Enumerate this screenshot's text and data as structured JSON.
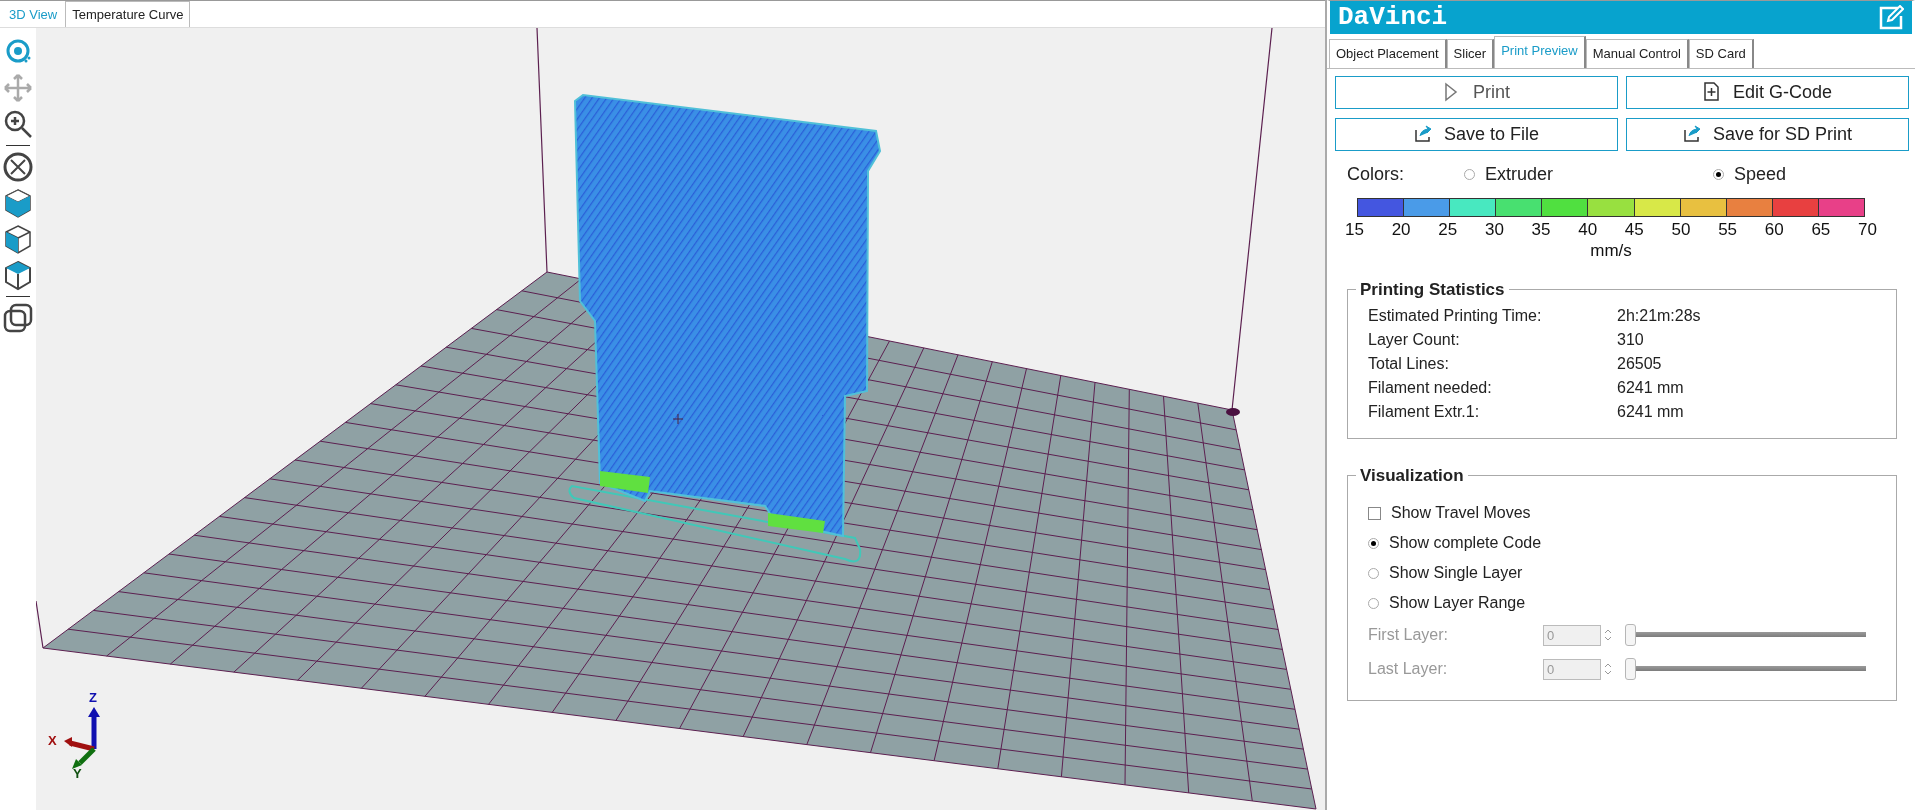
{
  "view_tabs": [
    {
      "label": "3D View",
      "selected": true
    },
    {
      "label": "Temperature Curve",
      "selected": false
    }
  ],
  "tools": [
    {
      "kind": "rotate",
      "selected": true,
      "disabled": false
    },
    {
      "kind": "move",
      "selected": false,
      "disabled": true
    },
    {
      "kind": "zoom",
      "selected": false,
      "disabled": false
    },
    {
      "kind": "separator"
    },
    {
      "kind": "fit",
      "selected": false,
      "disabled": false
    },
    {
      "kind": "cube-front",
      "selected": false,
      "disabled": false
    },
    {
      "kind": "cube-side",
      "selected": false,
      "disabled": false
    },
    {
      "kind": "cube-top",
      "selected": false,
      "disabled": false
    },
    {
      "kind": "separator"
    },
    {
      "kind": "views",
      "selected": false,
      "disabled": false
    }
  ],
  "axes": {
    "x": "X",
    "y": "Y",
    "z": "Z"
  },
  "panel": {
    "title": "DaVinci",
    "tabs": [
      {
        "label": "Object Placement",
        "selected": false
      },
      {
        "label": "Slicer",
        "selected": false
      },
      {
        "label": "Print Preview",
        "selected": true
      },
      {
        "label": "Manual Control",
        "selected": false
      },
      {
        "label": "SD Card",
        "selected": false
      }
    ],
    "buttons": [
      {
        "kind": "play",
        "label": "Print"
      },
      {
        "kind": "file",
        "label": "Edit G-Code"
      },
      {
        "kind": "export",
        "label": "Save to File"
      },
      {
        "kind": "export",
        "label": "Save for SD Print"
      }
    ],
    "colors_label": "Colors:",
    "color_modes": [
      {
        "label": "Extruder",
        "selected": false
      },
      {
        "label": "Speed",
        "selected": true
      }
    ],
    "legend": {
      "swatches": [
        {
          "color": "#4456e0"
        },
        {
          "color": "#4a9be8"
        },
        {
          "color": "#48e8c0"
        },
        {
          "color": "#48e070"
        },
        {
          "color": "#50e040"
        },
        {
          "color": "#98e040"
        },
        {
          "color": "#d8e848"
        },
        {
          "color": "#e8c040"
        },
        {
          "color": "#e88040"
        },
        {
          "color": "#e84040"
        },
        {
          "color": "#e84088"
        }
      ],
      "ticks": [
        "15",
        "20",
        "25",
        "30",
        "35",
        "40",
        "45",
        "50",
        "55",
        "60",
        "65",
        "70"
      ],
      "unit": "mm/s"
    },
    "statistics": {
      "title": "Printing Statistics",
      "rows": [
        {
          "label": "Estimated Printing Time:",
          "value": "2h:21m:28s"
        },
        {
          "label": "Layer Count:",
          "value": "310"
        },
        {
          "label": "Total Lines:",
          "value": "26505"
        },
        {
          "label": "Filament needed:",
          "value": "6241 mm"
        },
        {
          "label": "Filament Extr.1:",
          "value": "6241 mm"
        }
      ]
    },
    "visualization": {
      "title": "Visualization",
      "travel": {
        "label": "Show Travel Moves",
        "checked": false
      },
      "modes": [
        {
          "label": "Show complete Code",
          "selected": true
        },
        {
          "label": "Show Single Layer",
          "selected": false
        },
        {
          "label": "Show Layer Range",
          "selected": false
        }
      ],
      "layers": [
        {
          "label": "First Layer:",
          "value": "0",
          "level": 0,
          "disabled": true
        },
        {
          "label": "Last Layer:",
          "value": "0",
          "level": 0,
          "disabled": true
        }
      ]
    }
  }
}
